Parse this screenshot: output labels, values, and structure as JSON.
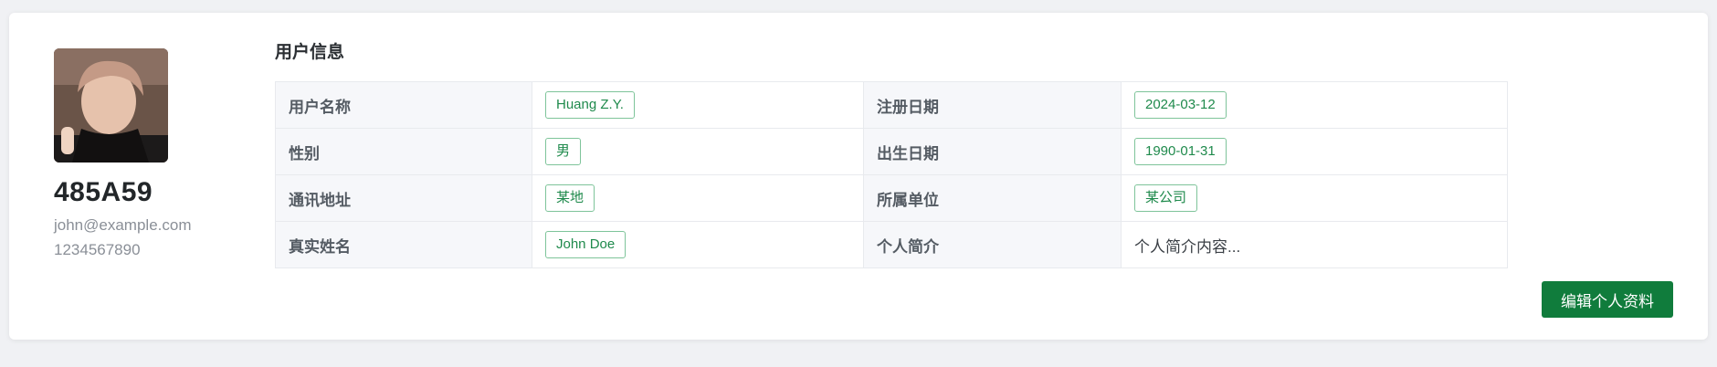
{
  "profile": {
    "username": "485A59",
    "email": "john@example.com",
    "phone": "1234567890"
  },
  "info": {
    "title": "用户信息",
    "rows": [
      [
        {
          "label": "用户名称",
          "value": "Huang Z.Y.",
          "tag": true
        },
        {
          "label": "注册日期",
          "value": "2024-03-12",
          "tag": true
        }
      ],
      [
        {
          "label": "性别",
          "value": "男",
          "tag": true
        },
        {
          "label": "出生日期",
          "value": "1990-01-31",
          "tag": true
        }
      ],
      [
        {
          "label": "通讯地址",
          "value": "某地",
          "tag": true
        },
        {
          "label": "所属单位",
          "value": "某公司",
          "tag": true
        }
      ],
      [
        {
          "label": "真实姓名",
          "value": "John Doe",
          "tag": true
        },
        {
          "label": "个人简介",
          "value": "个人简介内容...",
          "tag": false
        }
      ]
    ]
  },
  "actions": {
    "edit_label": "编辑个人资料"
  },
  "colors": {
    "accent": "#107c3c",
    "tag_border": "#7ec49a",
    "tag_text": "#1f8a4c"
  }
}
